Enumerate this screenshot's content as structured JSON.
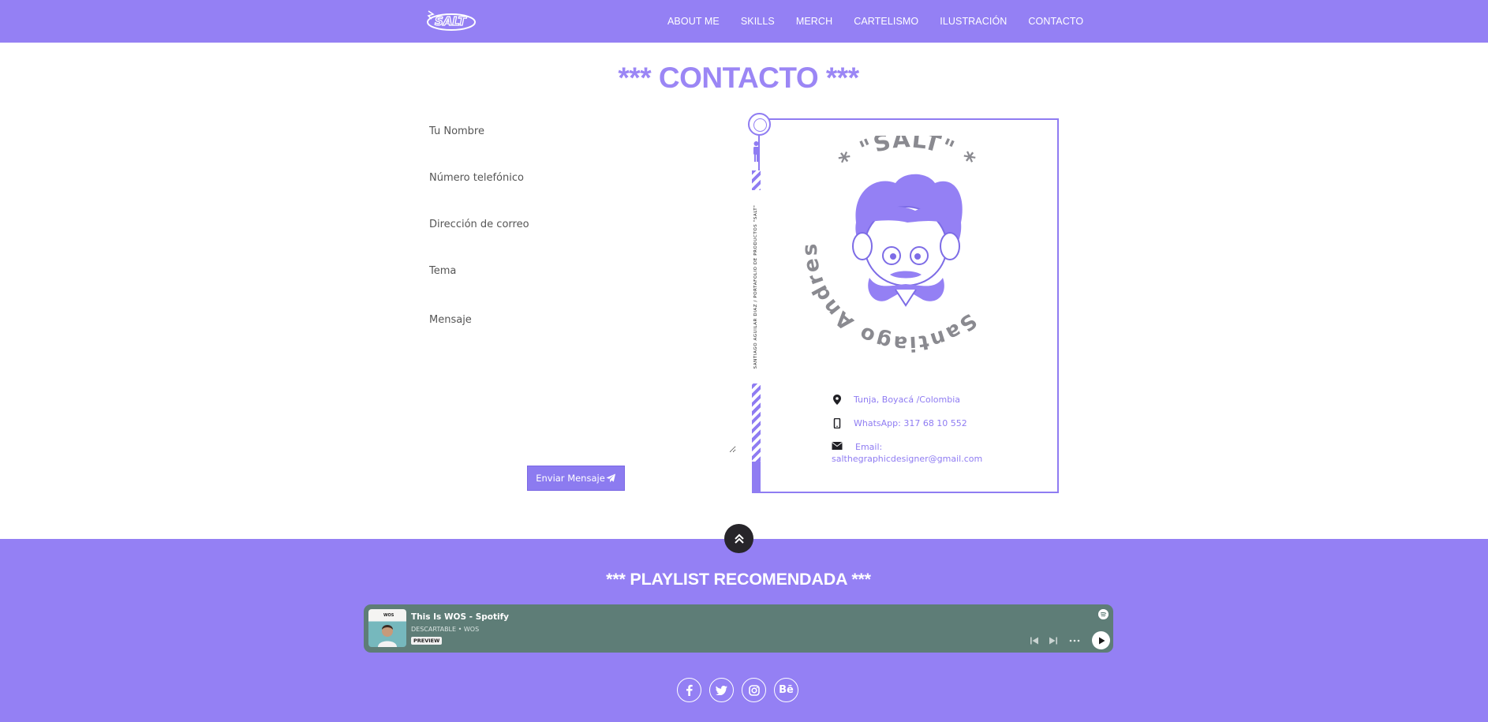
{
  "nav": {
    "logo_text": "SALT",
    "links": [
      "ABOUT ME",
      "SKILLS",
      "MERCH",
      "CARTELISMO",
      "ILUSTRACIÓN",
      "CONTACTO"
    ]
  },
  "contact": {
    "heading": "*** CONTACTO ***",
    "form": {
      "name_placeholder": "Tu Nombre",
      "phone_placeholder": "Número telefónico",
      "email_placeholder": "Dirección de correo",
      "subject_placeholder": "Tema",
      "message_placeholder": "Mensaje",
      "send_label": "Enviar Mensaje"
    },
    "card": {
      "seal_top": "* \"SALT\" *",
      "seal_name": "Santiago Andres Aguilar Diaz",
      "vertical_text": "SANTIAGO AGUILAR DIAZ / PORTAFOLIO DE PRODUCTOS \"SALT\"",
      "location": "Tunja, Boyacá /Colombia",
      "whatsapp": "WhatsApp: 317 68 10 552",
      "email_label": "Email:",
      "email": "salthegraphicdesigner@gmail.com"
    }
  },
  "footer": {
    "playlist_title": "*** PLAYLIST RECOMENDADA ***",
    "spotify": {
      "title": "This Is WOS - Spotify",
      "subtitle": "DESCARTABLE • WOS",
      "badge": "PREVIEW",
      "cover_text": "WOS"
    },
    "socials": [
      "facebook-icon",
      "twitter-icon",
      "instagram-icon",
      "behance-icon"
    ],
    "behance_label": "Bē"
  },
  "colors": {
    "accent": "#9480f4",
    "heading": "#9b86f5",
    "spotify_bg": "#5e7d77",
    "dark_button": "#27252a"
  }
}
